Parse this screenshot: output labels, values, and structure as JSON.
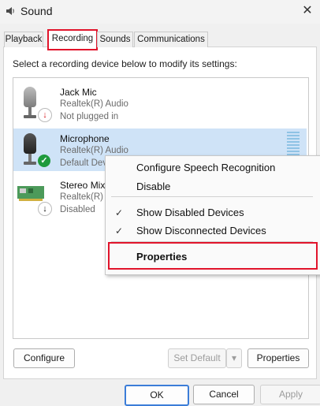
{
  "window": {
    "title": "Sound",
    "close_glyph": "✕"
  },
  "tabs": [
    {
      "label": "Playback"
    },
    {
      "label": "Recording"
    },
    {
      "label": "Sounds"
    },
    {
      "label": "Communications"
    }
  ],
  "instruction": "Select a recording device below to modify its settings:",
  "devices": [
    {
      "name": "Jack Mic",
      "driver": "Realtek(R) Audio",
      "status": "Not plugged in",
      "badge": "red-down-arrow"
    },
    {
      "name": "Microphone",
      "driver": "Realtek(R) Audio",
      "status": "Default Dev",
      "badge": "green-check"
    },
    {
      "name": "Stereo Mix",
      "driver": "Realtek(R) A",
      "status": "Disabled",
      "badge": "black-down-arrow"
    }
  ],
  "context_menu": {
    "items": [
      {
        "label": "Configure Speech Recognition",
        "checked": false
      },
      {
        "label": "Disable",
        "checked": false
      },
      {
        "label": "Show Disabled Devices",
        "checked": true
      },
      {
        "label": "Show Disconnected Devices",
        "checked": true
      },
      {
        "label": "Properties",
        "checked": false
      }
    ],
    "check_glyph": "✓"
  },
  "buttons": {
    "configure": "Configure",
    "set_default": "Set Default",
    "set_default_arrow": "▾",
    "properties": "Properties",
    "ok": "OK",
    "cancel": "Cancel",
    "apply": "Apply"
  },
  "colors": {
    "highlight_red": "#e1142b",
    "selected_row": "#cfe3f7",
    "ok_focus": "#3b7dd8"
  }
}
